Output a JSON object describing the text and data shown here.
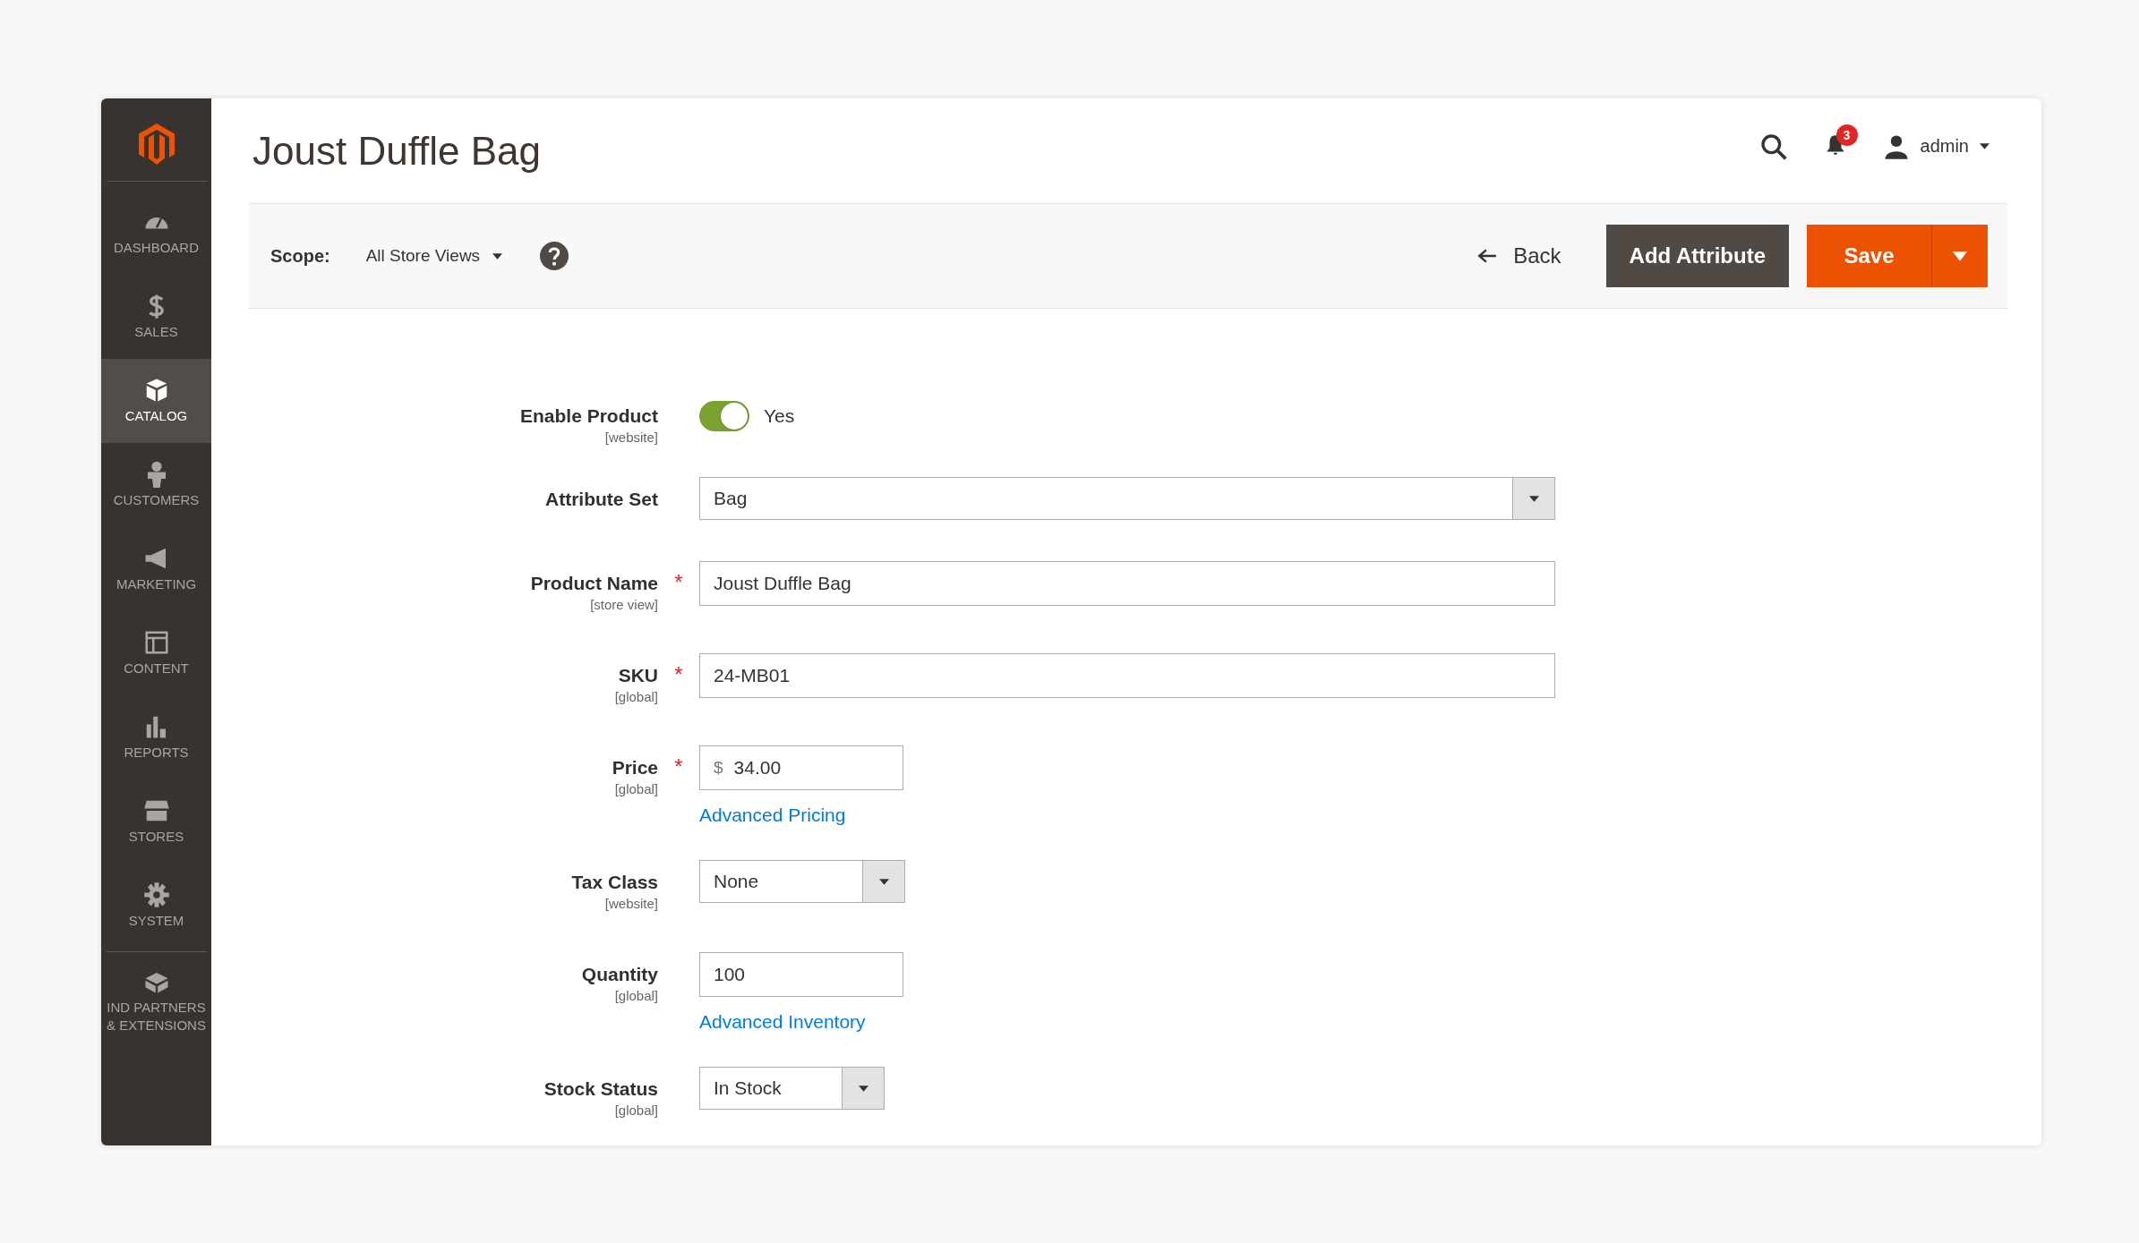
{
  "sidebar": {
    "items": [
      {
        "label": "DASHBOARD",
        "selected": false
      },
      {
        "label": "SALES",
        "selected": false
      },
      {
        "label": "CATALOG",
        "selected": true
      },
      {
        "label": "CUSTOMERS",
        "selected": false
      },
      {
        "label": "MARKETING",
        "selected": false
      },
      {
        "label": "CONTENT",
        "selected": false
      },
      {
        "label": "REPORTS",
        "selected": false
      },
      {
        "label": "STORES",
        "selected": false
      },
      {
        "label": "SYSTEM",
        "selected": false
      },
      {
        "label": "IND PARTNERS & EXTENSIONS",
        "selected": false
      }
    ]
  },
  "header": {
    "title": "Joust Duffle Bag",
    "notification_count": "3",
    "user": "admin"
  },
  "toolbar": {
    "scope_label": "Scope:",
    "scope_value": "All Store Views",
    "back": "Back",
    "add_attribute": "Add Attribute",
    "save": "Save"
  },
  "form": {
    "fields": [
      {
        "kind": "toggle",
        "label": "Enable Product",
        "scope": "[website]",
        "on": true,
        "value": "Yes"
      },
      {
        "kind": "wide-select",
        "label": "Attribute Set",
        "value": "Bag"
      },
      {
        "kind": "wide-text",
        "label": "Product Name",
        "scope": "[store view]",
        "required_mark": "*",
        "value": "Joust Duffle Bag"
      },
      {
        "kind": "wide-text",
        "label": "SKU",
        "scope": "[global]",
        "required_mark": "*",
        "value": "24-MB01"
      },
      {
        "kind": "price",
        "label": "Price",
        "scope": "[global]",
        "required_mark": "*",
        "currency": "$",
        "value": "34.00",
        "link": "Advanced Pricing"
      },
      {
        "kind": "select",
        "label": "Tax Class",
        "scope": "[website]",
        "value": "None"
      },
      {
        "kind": "text",
        "label": "Quantity",
        "scope": "[global]",
        "value": "100",
        "link": "Advanced Inventory"
      },
      {
        "kind": "small-select",
        "label": "Stock Status",
        "scope": "[global]",
        "value": "In Stock"
      }
    ]
  }
}
